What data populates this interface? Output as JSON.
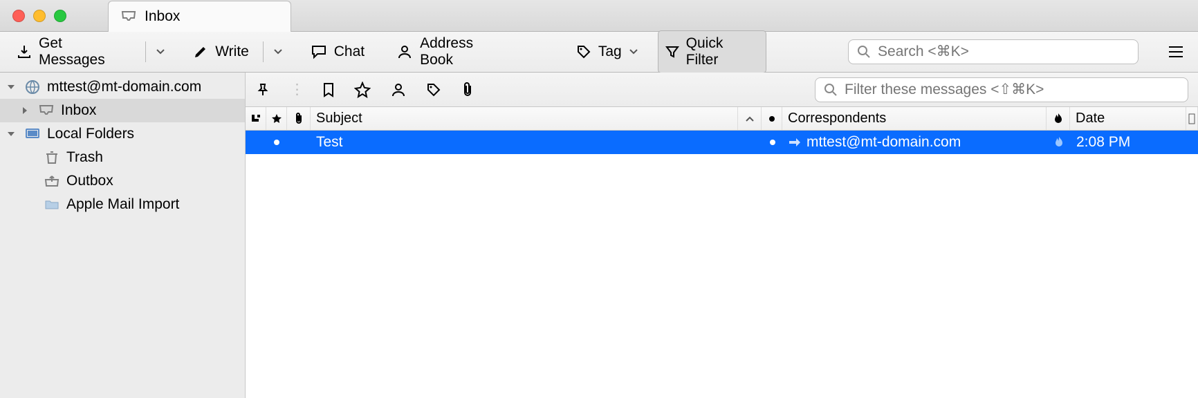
{
  "titlebar": {
    "tab_label": "Inbox"
  },
  "toolbar": {
    "get_messages": "Get Messages",
    "write": "Write",
    "chat": "Chat",
    "address_book": "Address Book",
    "tag": "Tag",
    "quick_filter": "Quick Filter",
    "search_placeholder": "Search <⌘K>"
  },
  "sidebar": {
    "account": "mttest@mt-domain.com",
    "inbox": "Inbox",
    "local_folders": "Local Folders",
    "trash": "Trash",
    "outbox": "Outbox",
    "apple_mail_import": "Apple Mail Import"
  },
  "filterbar": {
    "placeholder": "Filter these messages <⇧⌘K>"
  },
  "columns": {
    "subject": "Subject",
    "correspondents": "Correspondents",
    "date": "Date"
  },
  "messages": [
    {
      "unread": true,
      "subject": "Test",
      "correspondent": "mttest@mt-domain.com",
      "direction": "outgoing",
      "date": "2:08 PM",
      "flagged_hot": true
    }
  ]
}
